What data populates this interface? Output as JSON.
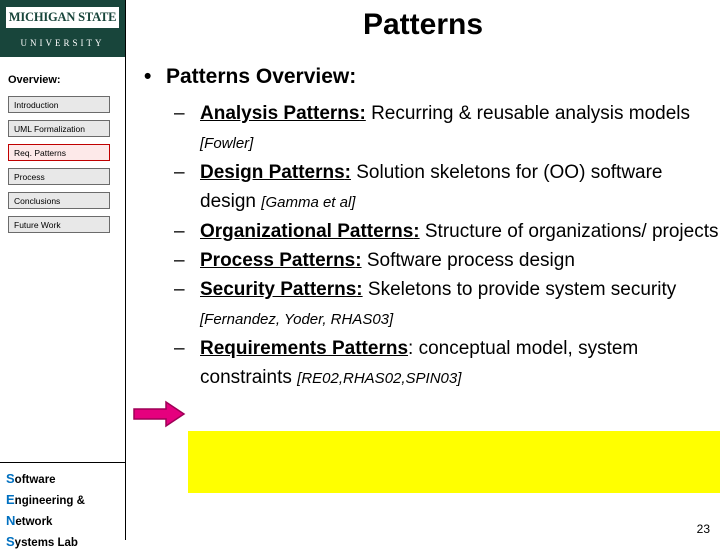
{
  "logo": {
    "top_text": "MICHIGAN STATE",
    "bottom_text": "UNIVERSITY"
  },
  "sidebar": {
    "heading": "Overview:",
    "items": [
      {
        "label": "Introduction",
        "active": false
      },
      {
        "label": "UML Formalization",
        "active": false
      },
      {
        "label": "Req. Patterns",
        "active": true
      },
      {
        "label": "Process",
        "active": false
      },
      {
        "label": "Conclusions",
        "active": false
      },
      {
        "label": "Future Work",
        "active": false
      }
    ],
    "lab": {
      "l1_cap": "S",
      "l1_rest": "oftware",
      "l2_cap": "E",
      "l2_rest": "ngineering &",
      "l3_cap": "N",
      "l3_rest": "etwork",
      "l4_cap": "S",
      "l4_rest": "ystems Lab"
    }
  },
  "title": "Patterns",
  "body": {
    "bullet_marker": "•",
    "level1": "Patterns Overview:",
    "dash": "–",
    "items": [
      {
        "term": "Analysis Patterns",
        "colon": ":",
        "text": " Recurring & reusable analysis models ",
        "cite": "[Fowler]"
      },
      {
        "term": "Design Patterns",
        "colon": ":",
        "text": " Solution skeletons for (OO) software design ",
        "cite": "[Gamma et al]"
      },
      {
        "term": "Organizational Patterns",
        "colon": ":",
        "text": " Structure of organizations/ projects",
        "cite": ""
      },
      {
        "term": "Process Patterns",
        "colon": ":",
        "text": " Software process design",
        "cite": ""
      },
      {
        "term": "Security Patterns",
        "colon": ":",
        "text": " Skeletons to provide system security ",
        "cite": "[Fernandez, Yoder, RHAS03]"
      },
      {
        "term": "Requirements Patterns",
        "colon": ":",
        "text": " conceptual model, system constraints ",
        "cite": "[RE02,RHAS02,SPIN03]"
      }
    ]
  },
  "page_number": "23",
  "colors": {
    "msu_green": "#18453B",
    "highlight": "#ffff00",
    "arrow_fill": "#e5007e",
    "active_nav_border": "#c00000",
    "lab_accent": "#0070c0"
  }
}
